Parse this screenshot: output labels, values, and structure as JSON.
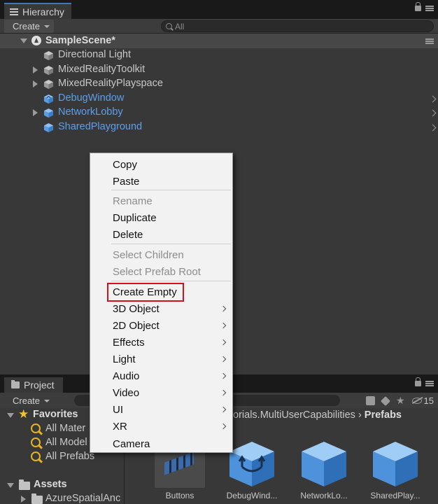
{
  "hierarchy": {
    "tab_label": "Hierarchy",
    "create_label": "Create",
    "search_placeholder": "All",
    "scene_name": "SampleScene*",
    "items": [
      {
        "label": "Directional Light"
      },
      {
        "label": "MixedRealityToolkit"
      },
      {
        "label": "MixedRealityPlayspace"
      },
      {
        "label": "DebugWindow"
      },
      {
        "label": "NetworkLobby"
      },
      {
        "label": "SharedPlayground"
      }
    ]
  },
  "context_menu": {
    "items": [
      {
        "label": "Copy",
        "enabled": true
      },
      {
        "label": "Paste",
        "enabled": true
      },
      {
        "label": "Rename",
        "enabled": false
      },
      {
        "label": "Duplicate",
        "enabled": true
      },
      {
        "label": "Delete",
        "enabled": true
      },
      {
        "label": "Select Children",
        "enabled": false
      },
      {
        "label": "Select Prefab Root",
        "enabled": false
      },
      {
        "label": "Create Empty",
        "enabled": true,
        "highlighted": true
      },
      {
        "label": "3D Object",
        "submenu": true
      },
      {
        "label": "2D Object",
        "submenu": true
      },
      {
        "label": "Effects",
        "submenu": true
      },
      {
        "label": "Light",
        "submenu": true
      },
      {
        "label": "Audio",
        "submenu": true
      },
      {
        "label": "Video",
        "submenu": true
      },
      {
        "label": "UI",
        "submenu": true
      },
      {
        "label": "XR",
        "submenu": true
      },
      {
        "label": "Camera",
        "submenu": false
      }
    ],
    "highlight_color": "#d0131a"
  },
  "project": {
    "tab_label": "Project",
    "create_label": "Create",
    "hidden_count": "15",
    "favorites_title": "Favorites",
    "favorites": [
      {
        "label": "All Mater"
      },
      {
        "label": "All Model"
      },
      {
        "label": "All Prefabs"
      }
    ],
    "assets_title": "Assets",
    "asset_children": [
      {
        "label": "AzureSpatialAnc"
      }
    ],
    "breadcrumb_path": "torials.MultiUserCapabilities",
    "breadcrumb_current": "Prefabs",
    "assets_grid": [
      {
        "label": "Buttons",
        "icon": "button-strip-thumbnail"
      },
      {
        "label": "DebugWind...",
        "icon": "prefab-variant-cube-icon"
      },
      {
        "label": "NetworkLo...",
        "icon": "prefab-cube-icon"
      },
      {
        "label": "SharedPlay...",
        "icon": "prefab-cube-icon"
      }
    ]
  },
  "colors": {
    "panel_bg": "#383838",
    "prefab_blue": "#5c9fea",
    "menu_bg": "#f2f2f2",
    "accent_tab": "#3a79bb"
  }
}
